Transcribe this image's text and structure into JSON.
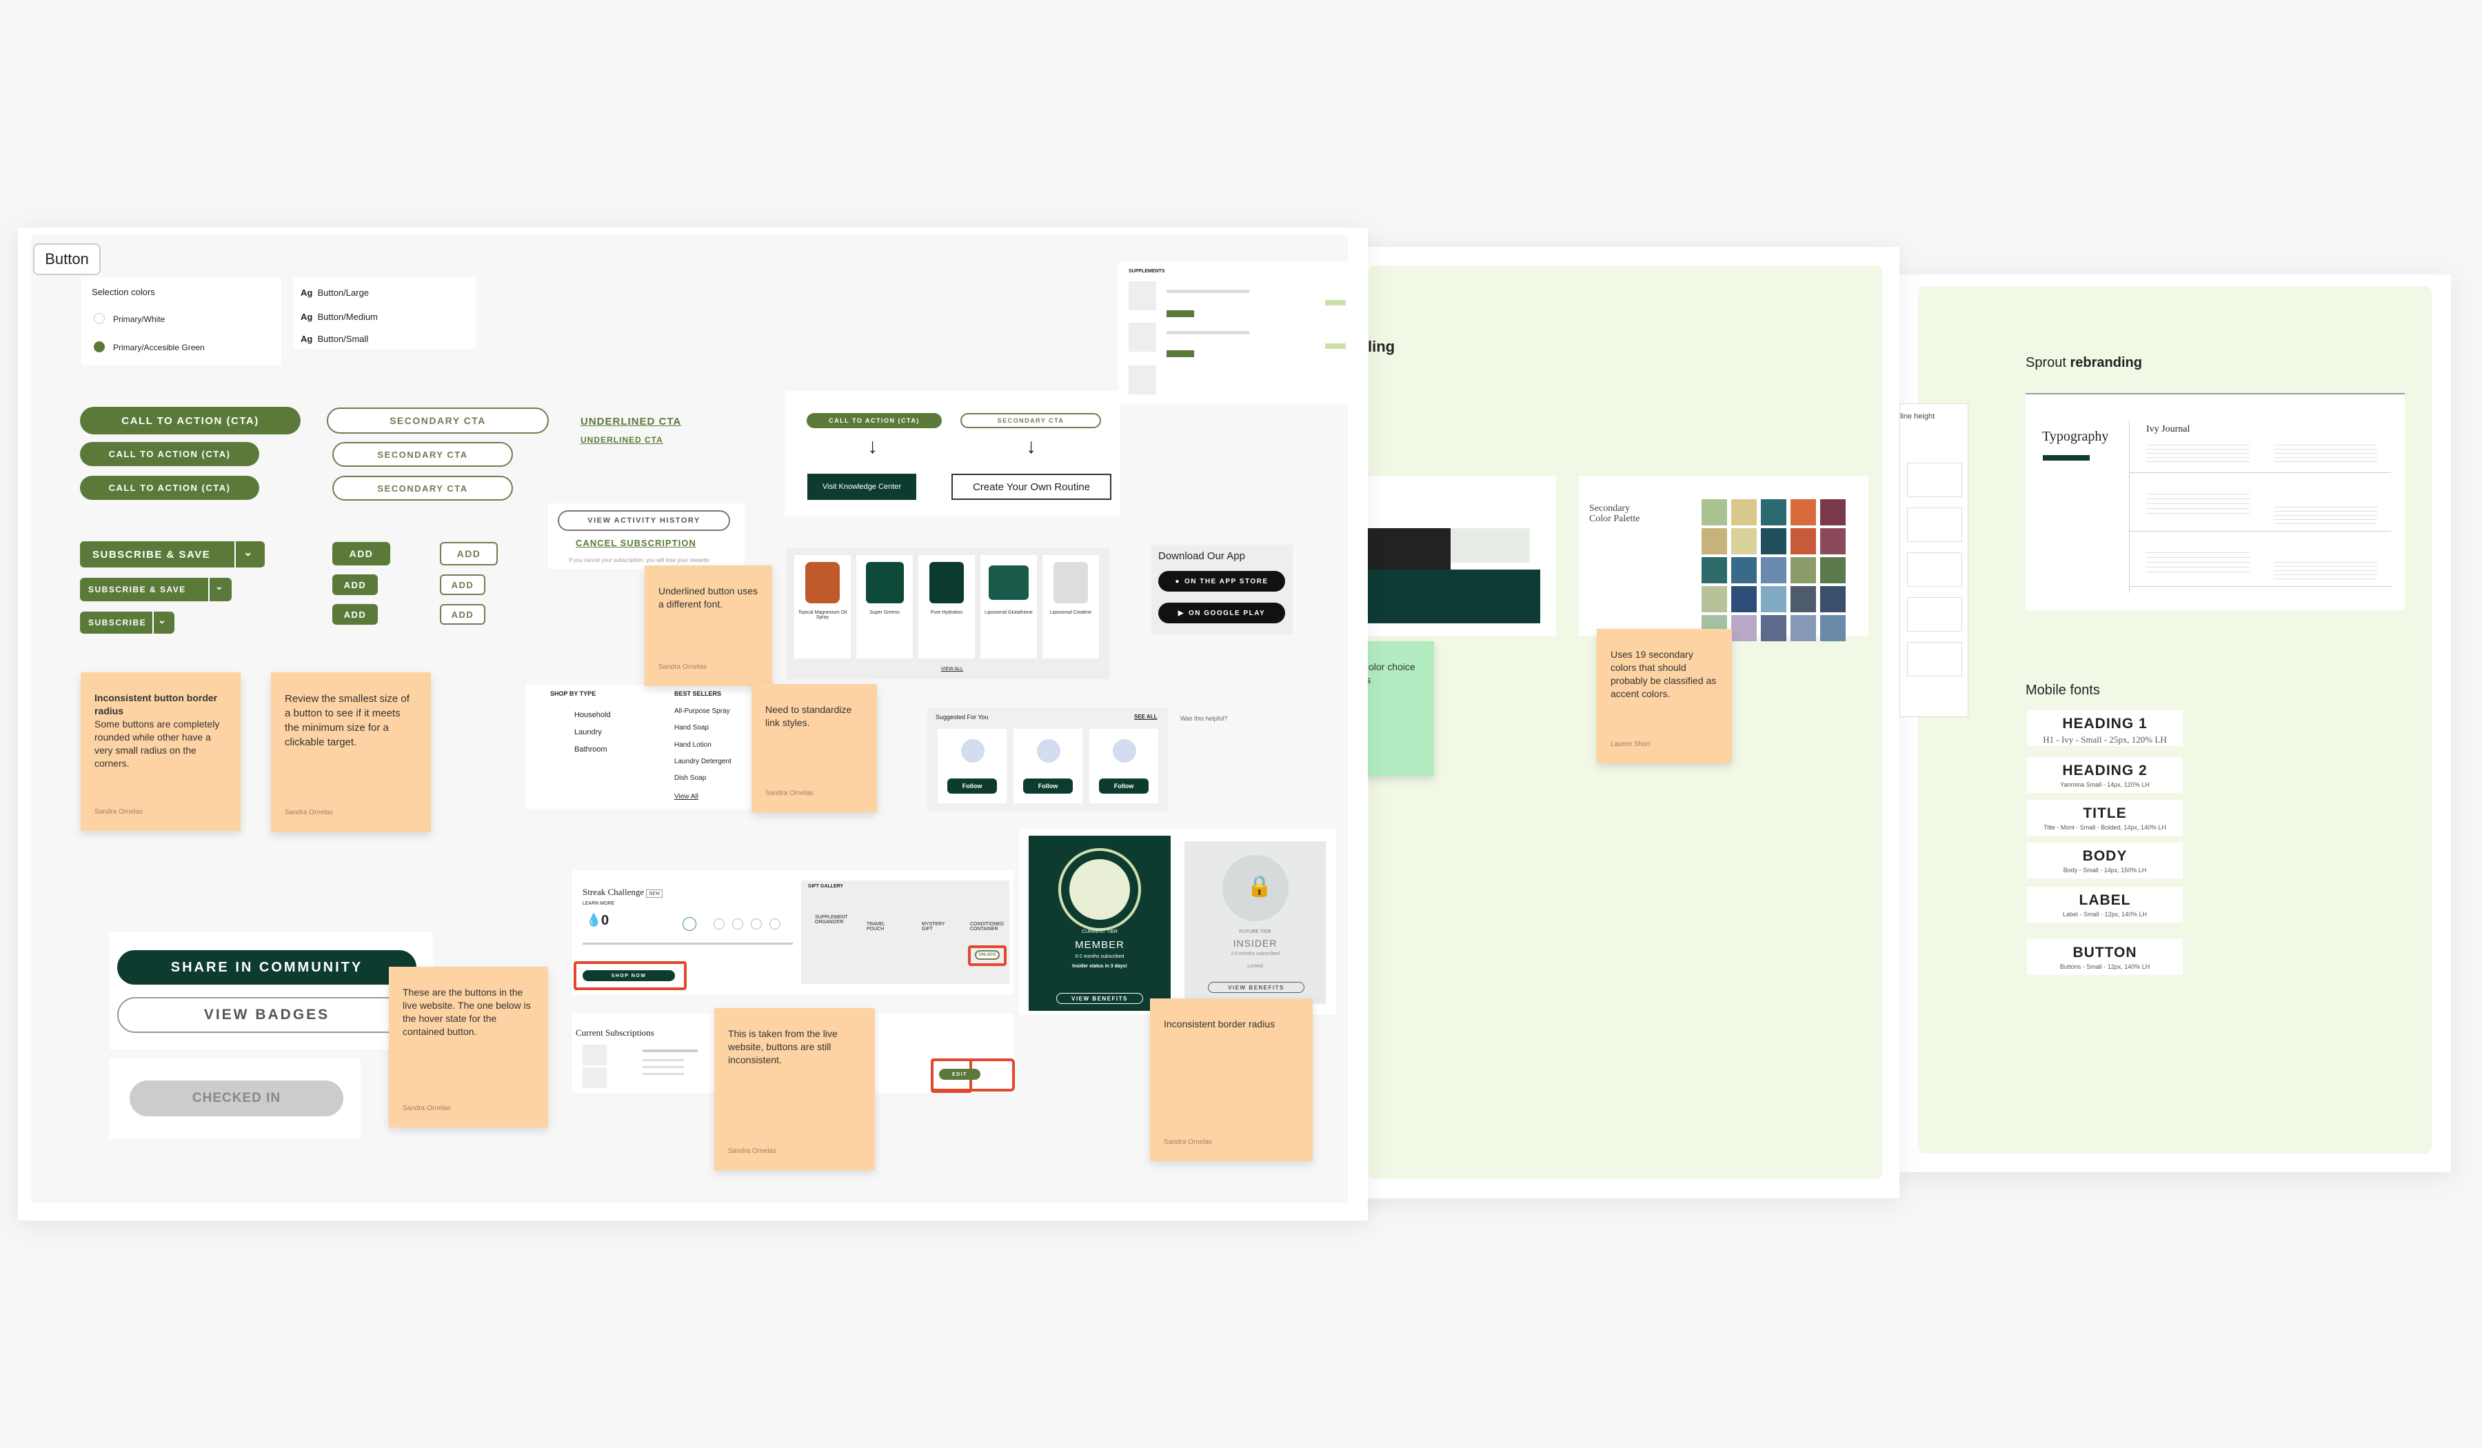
{
  "frame": {
    "title": "Button"
  },
  "selection_colors": {
    "title": "Selection colors",
    "items": [
      "Primary/White",
      "Primary/Accesible Green"
    ]
  },
  "text_styles": [
    "Button/Large",
    "Button/Medium",
    "Button/Small"
  ],
  "text_style_glyph": "Ag",
  "buttons": {
    "cta": "CALL TO ACTION (CTA)",
    "secondary": "SECONDARY CTA",
    "underlined": "UNDERLINED CTA",
    "subscribe_save": "SUBSCRIBE & SAVE",
    "subscribe": "SUBSCRIBE",
    "add": "ADD",
    "view_activity": "VIEW ACTIVITY HISTORY",
    "cancel_subscription": "CANCEL SUBSCRIPTION",
    "cancel_note": "If you cancel your subscription, you will lose your rewards",
    "visit_knowledge": "Visit Knowledge Center",
    "create_routine": "Create Your Own Routine",
    "share_community": "SHARE IN COMMUNITY",
    "view_badges": "VIEW BADGES",
    "checked_in": "CHECKED IN"
  },
  "app_download": {
    "title": "Download Our App",
    "app_store": "ON THE APP STORE",
    "google_play": "ON GOOGLE PLAY"
  },
  "supplements": {
    "title": "SUPPLEMENTS"
  },
  "products": {
    "items": [
      "Topical Magnesium Oil Spray",
      "Super Greens",
      "Pure Hydration",
      "Liposomal Glutathione",
      "Liposomal Creatine"
    ],
    "view_all": "VIEW ALL"
  },
  "shop_by_type": {
    "title": "SHOP BY TYPE",
    "items": [
      "Household",
      "Laundry",
      "Bathroom"
    ]
  },
  "best_sellers": {
    "title": "BEST SELLERS",
    "items": [
      "All-Purpose Spray",
      "Hand Soap",
      "Hand Lotion",
      "Laundry Detergent",
      "Dish Soap"
    ],
    "view_all": "View All"
  },
  "suggested": {
    "title": "Suggested For You",
    "see_all": "SEE ALL",
    "follow": "Follow",
    "helpful": "Was this helpful?"
  },
  "streak": {
    "title": "Streak Challenge",
    "badge": "NEW",
    "learn_more": "LEARN MORE",
    "count": "0",
    "shop_now": "SHOP NOW"
  },
  "gift_gallery": {
    "title": "GIFT GALLERY",
    "items": [
      "SUPPLEMENT ORGANIZER",
      "TRAVEL POUCH",
      "MYSTERY GIFT",
      "CONDITIONED CONTAINER"
    ],
    "unlock": "UNLOCK"
  },
  "subscriptions": {
    "title": "Current Subscriptions",
    "edit": "EDIT"
  },
  "tiers": {
    "current": {
      "label": "CURRENT TIER",
      "name": "MEMBER",
      "desc": "0-2 months subscribed",
      "status": "Insider status in 3 days!",
      "button": "VIEW BENEFITS"
    },
    "future": {
      "label": "FUTURE TIER",
      "name": "INSIDER",
      "desc": "2-5 months subscribed",
      "status": "Locked",
      "button": "VIEW BENEFITS"
    }
  },
  "stickies": [
    {
      "title": "Inconsistent button border radius",
      "body": "Some buttons are completely rounded while other have a very small radius on the corners.",
      "author": "Sandra Ornelas"
    },
    {
      "body": "Review the smallest size of a button to see if it meets the minimum size for a clickable target.",
      "author": "Sandra Ornelas"
    },
    {
      "body": "Underlined button uses a different font.",
      "author": "Sandra Ornelas"
    },
    {
      "body": "Need to standardize link styles.",
      "author": "Sandra Ornelas"
    },
    {
      "body": "These are the buttons in the live website. The one below is the hover state for the contained button.",
      "author": "Sandra Ornelas"
    },
    {
      "body": "This is taken from the live website, buttons are still inconsistent.",
      "author": "Sandra Ornelas"
    },
    {
      "body": "Inconsistent border radius",
      "author": "Sandra Ornelas"
    },
    {
      "body": "Uses 19 secondary colors that should probably be classified as accent colors.",
      "author": "Lauren Short"
    },
    {
      "body": "color choice is"
    }
  ],
  "board2": {
    "title_fragment": "ling",
    "palette_title": "Secondary Color Palette"
  },
  "board3": {
    "title_prefix": "Sprout ",
    "title_bold": "rebranding",
    "line_height": "line height",
    "typography": "Typography",
    "ivy_journal": "Ivy Journal",
    "mobile_fonts_title": "Mobile fonts",
    "mobile_fonts": [
      {
        "name": "HEADING 1",
        "spec": "H1 - Ivy - Small - 25px, 120% LH"
      },
      {
        "name": "HEADING 2",
        "spec": "Yanmina Small - 14px, 120% LH"
      },
      {
        "name": "TITLE",
        "spec": "Title - Mont - Small - Bolded, 14px, 140% LH"
      },
      {
        "name": "BODY",
        "spec": "Body - Small - 14px, 150% LH"
      },
      {
        "name": "LABEL",
        "spec": "Label - Small - 12px, 140% LH"
      },
      {
        "name": "BUTTON",
        "spec": "Buttons - Small - 12px, 140% LH"
      }
    ]
  },
  "colors": {
    "brand_green": "#5b7a3a",
    "dark_green": "#0d3b30",
    "sticky_orange": "#fdd3a3",
    "sticky_green": "#b3ecc0",
    "board_bg": "#f1f8e6",
    "highlight_red": "#e2482f"
  },
  "palette_swatches": [
    "#a8c493",
    "#d8c88c",
    "#2a6a70",
    "#d86a3c",
    "#7a3a4a",
    "#c6b27a",
    "#d8d19a",
    "#1f4f5a",
    "#c65a3a",
    "#8a4a5a",
    "#2f6a6a",
    "#3a6a8a",
    "#6a8ab0",
    "#8a9c6a",
    "#5b7a4a",
    "#b6c39a",
    "#2d4e78",
    "#7faac2",
    "#4d5b6c",
    "#3a4f6a",
    "#a3c2a3",
    "#b8a8c6",
    "#5e6a8c",
    "#8898b8",
    "#6a8aaa"
  ]
}
